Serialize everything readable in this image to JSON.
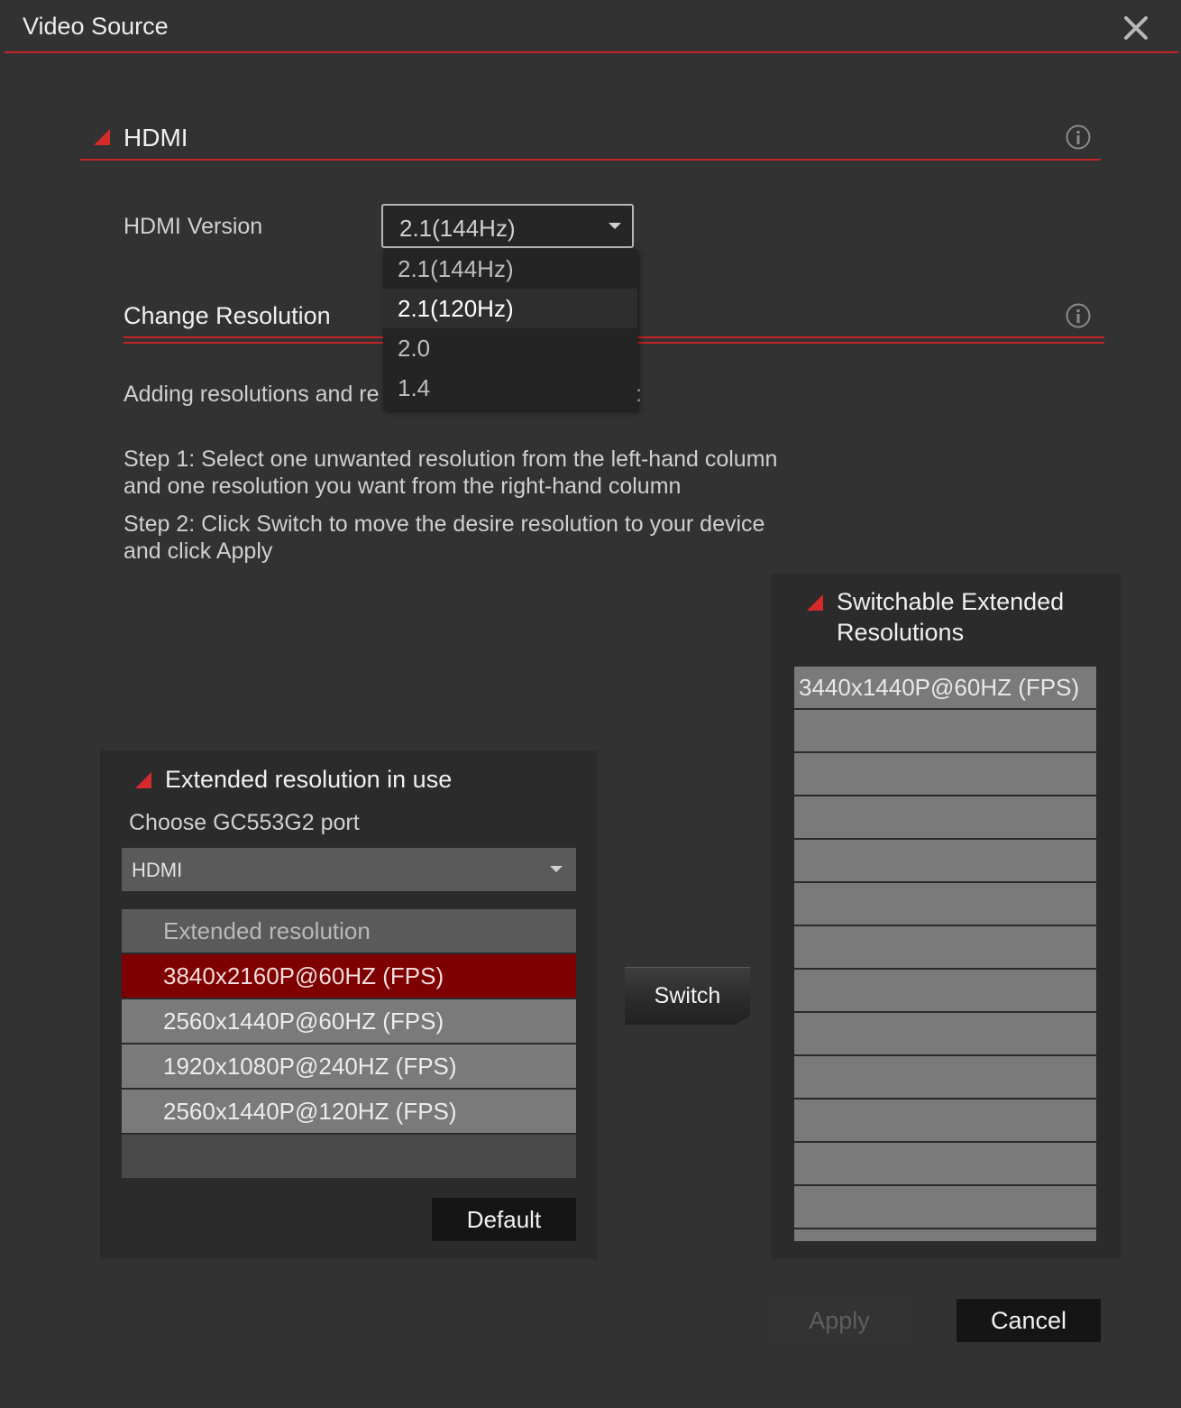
{
  "window": {
    "title": "Video Source",
    "close_icon": "close-icon"
  },
  "hdmi_section": {
    "label": "HDMI",
    "info_icon": "info-icon"
  },
  "hdmi_version": {
    "label": "HDMI Version",
    "selected": "2.1(144Hz)",
    "options": [
      "2.1(144Hz)",
      "2.1(120Hz)",
      "2.0",
      "1.4"
    ],
    "highlighted_option": "2.1(120Hz)"
  },
  "change_resolution": {
    "label": "Change Resolution",
    "info_icon": "info-icon",
    "description_visible": "Adding resolutions and re",
    "description_tail": ":",
    "step1_line1": "Step 1: Select one unwanted resolution from the left-hand column",
    "step1_line2": "and one resolution you want from the right-hand column",
    "step2_line1": "Step 2: Click Switch to move the desire resolution to your device",
    "step2_line2": "and click Apply"
  },
  "in_use_panel": {
    "title": "Extended resolution in use",
    "port_label": "Choose GC553G2 port",
    "port_selected": "HDMI",
    "list_header": "Extended resolution",
    "rows": [
      "3840x2160P@60HZ (FPS)",
      "2560x1440P@60HZ (FPS)",
      "1920x1080P@240HZ (FPS)",
      "2560x1440P@120HZ (FPS)"
    ],
    "selected_row": "3840x2160P@60HZ (FPS)",
    "default_button": "Default"
  },
  "switch_button": "Switch",
  "switchable_panel": {
    "title_line1": "Switchable Extended",
    "title_line2": "Resolutions",
    "rows": [
      "3440x1440P@60HZ (FPS)",
      "",
      "",
      "",
      "",
      "",
      "",
      "",
      "",
      "",
      "",
      "",
      "",
      ""
    ]
  },
  "footer": {
    "apply": "Apply",
    "cancel": "Cancel"
  },
  "colors": {
    "accent_red": "#c62424",
    "selected_row": "#7e0000",
    "background": "#323232"
  }
}
